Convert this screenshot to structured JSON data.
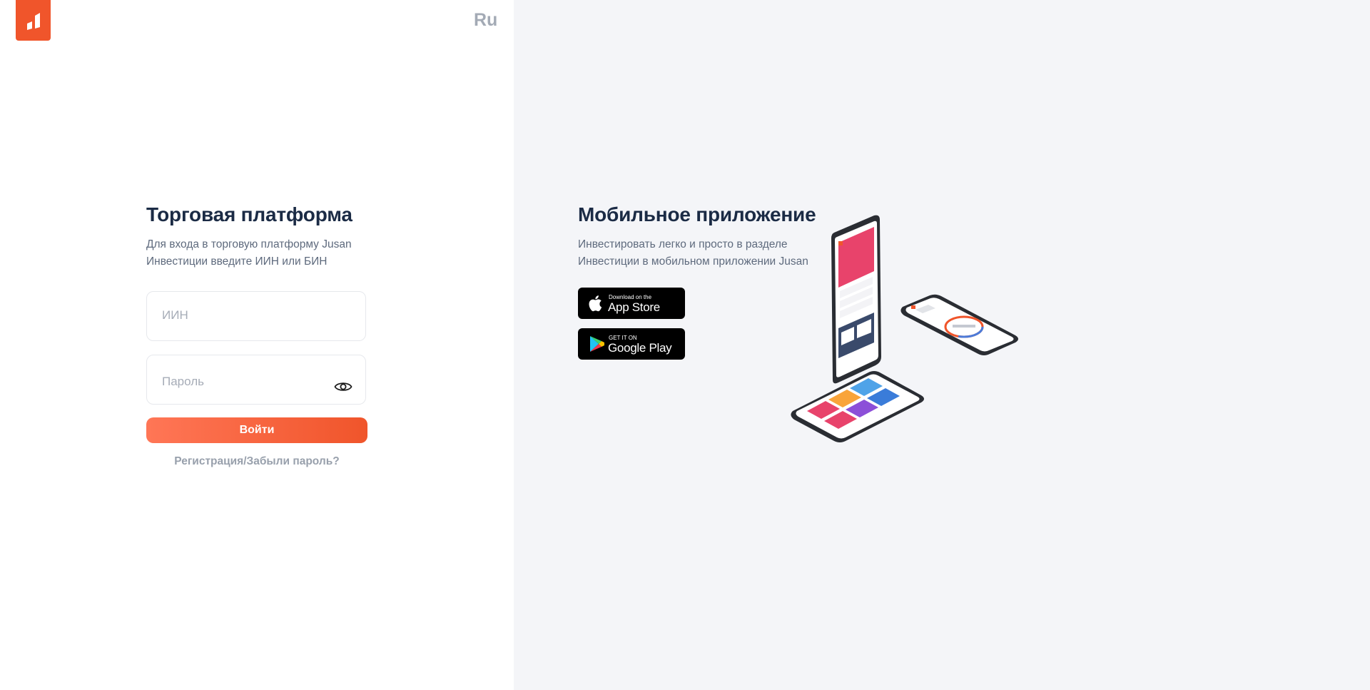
{
  "header": {
    "lang_label": "Ru"
  },
  "login": {
    "title": "Торговая платформа",
    "description_line1": "Для входа в торговую платформу Jusan",
    "description_line2": "Инвестиции введите ИИН или БИН",
    "iin_placeholder": "ИИН",
    "password_placeholder": "Пароль",
    "submit_label": "Войти",
    "register_link": "Регистрация/Забыли пароль?"
  },
  "mobile": {
    "title": "Мобильное приложение",
    "description_line1": "Инвестировать легко и просто в разделе",
    "description_line2": "Инвестиции в мобильном приложении Jusan",
    "app_store": {
      "small": "Download on the",
      "big": "App Store"
    },
    "google_play": {
      "small": "GET IT ON",
      "big": "Google Play"
    }
  },
  "colors": {
    "brand": "#f0552b",
    "heading": "#1b2b45",
    "muted": "#5e6a7d",
    "right_background": "#f4f5f8"
  },
  "icons": [
    "jusan-logo-icon",
    "eye-icon",
    "apple-icon",
    "google-play-icon"
  ]
}
